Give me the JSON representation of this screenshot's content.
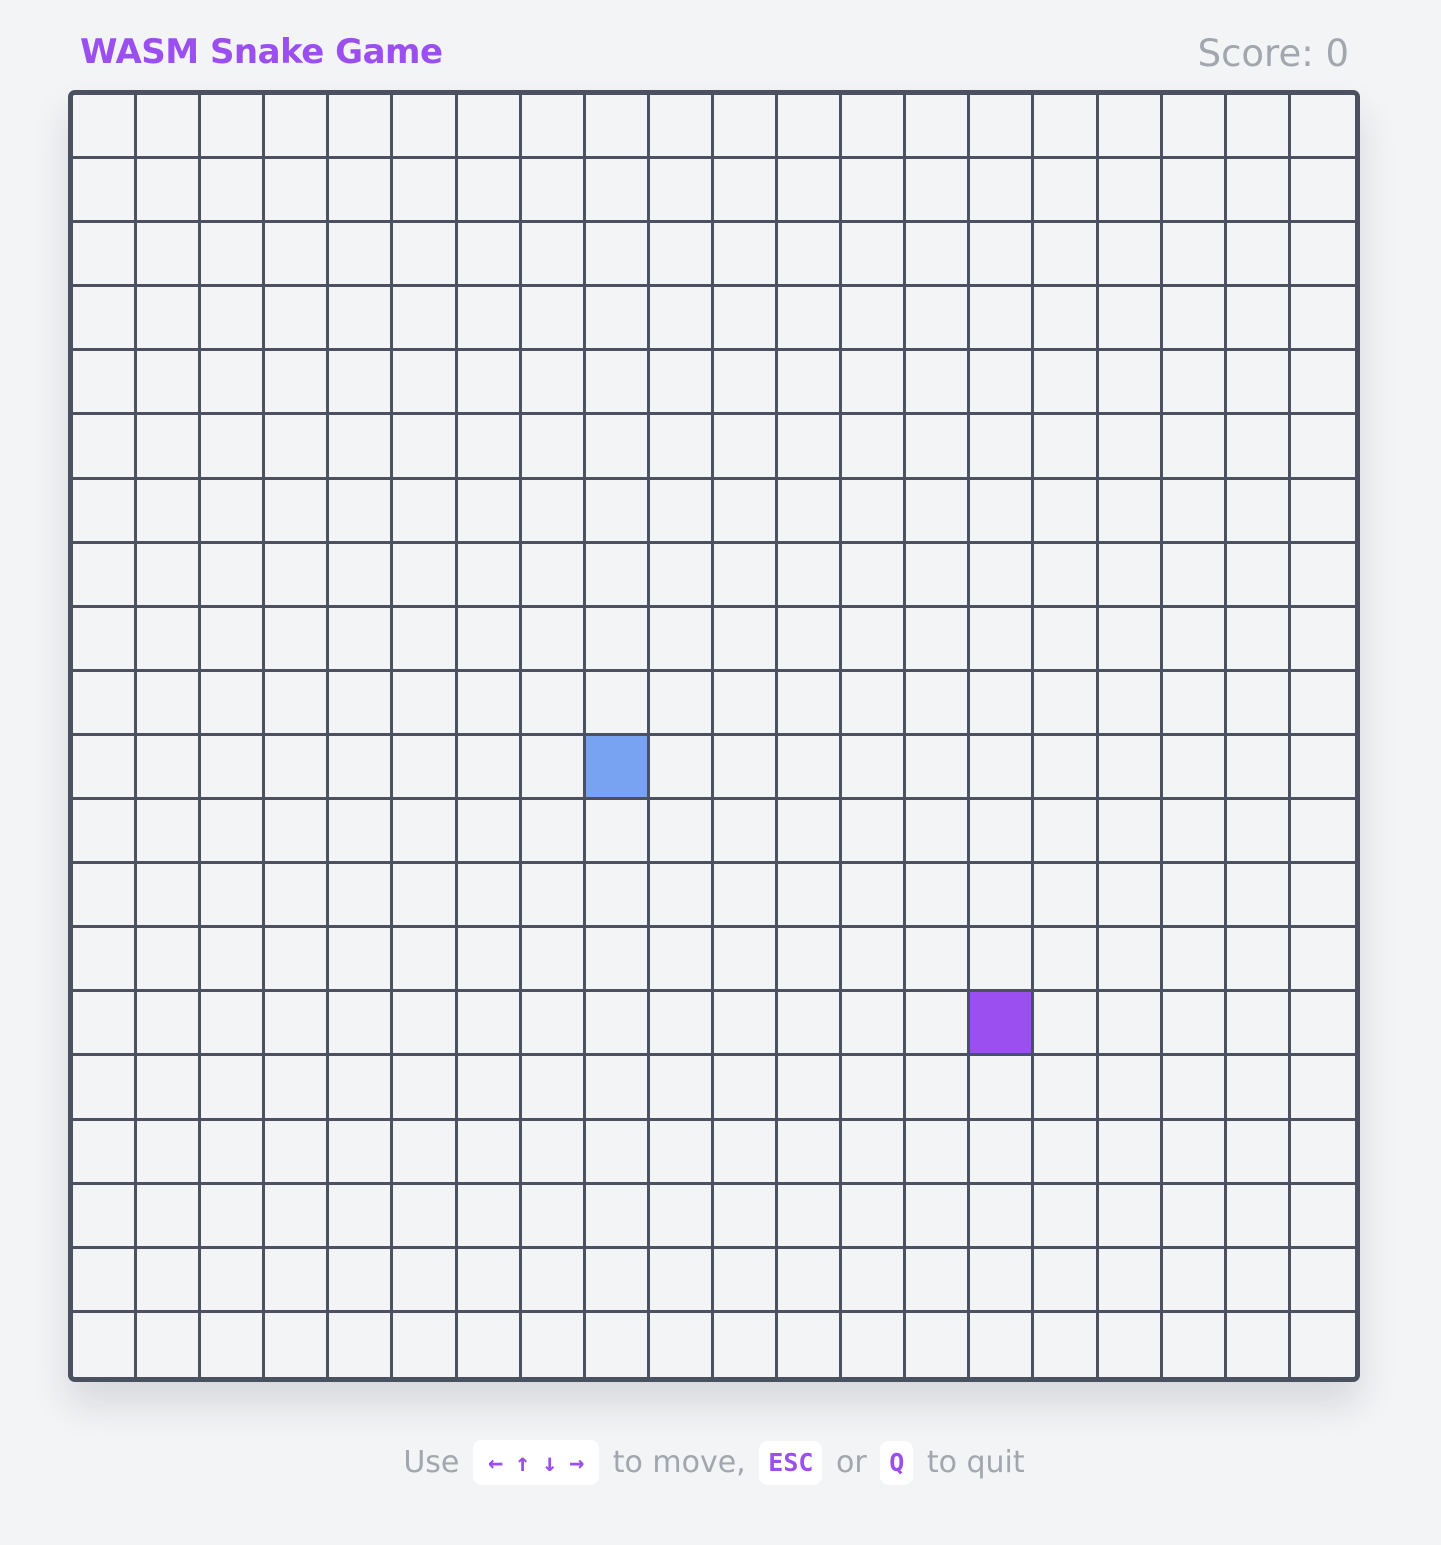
{
  "header": {
    "title": "WASM Snake Game",
    "score_label": "Score: 0"
  },
  "board": {
    "columns": 20,
    "rows": 20,
    "snake": [
      {
        "col": 8,
        "row": 10
      }
    ],
    "food": {
      "col": 14,
      "row": 14
    },
    "colors": {
      "snake": "#78a3f3",
      "food": "#9b4ff0"
    }
  },
  "instructions": {
    "prefix": "Use",
    "arrow_keys": [
      "←",
      "↑",
      "↓",
      "→"
    ],
    "move_text": "to move,",
    "escape_key": "ESC",
    "or_text": "or",
    "quit_key": "Q",
    "quit_text": "to quit"
  },
  "colors": {
    "accent": "#9b4ff0",
    "grid_line": "#4b5161",
    "background": "#f3f4f6",
    "muted_text": "#a2a6ae"
  }
}
